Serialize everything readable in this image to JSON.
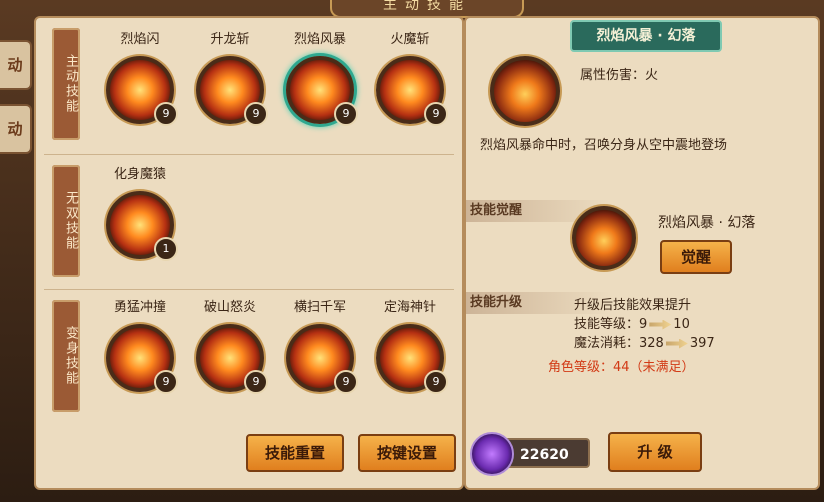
{
  "window": {
    "title": "主动技能"
  },
  "side_tabs": [
    "动",
    "动"
  ],
  "sections": [
    {
      "ribbon": "主动技能",
      "skills": [
        {
          "name": "烈焰闪",
          "level": "9"
        },
        {
          "name": "升龙斩",
          "level": "9"
        },
        {
          "name": "烈焰风暴",
          "level": "9",
          "selected": true
        },
        {
          "name": "火魔斩",
          "level": "9"
        }
      ]
    },
    {
      "ribbon": "无双技能",
      "skills": [
        {
          "name": "化身魔猿",
          "level": "1"
        }
      ]
    },
    {
      "ribbon": "变身技能",
      "skills": [
        {
          "name": "勇猛冲撞",
          "level": "9"
        },
        {
          "name": "破山怒炎",
          "level": "9"
        },
        {
          "name": "横扫千军",
          "level": "9"
        },
        {
          "name": "定海神针",
          "level": "9"
        }
      ]
    }
  ],
  "buttons": {
    "reset": "技能重置",
    "keybind": "按键设置",
    "awaken": "觉醒",
    "upgrade": "升 级"
  },
  "detail": {
    "title": "烈焰风暴 · 幻落",
    "attribute": "属性伤害：火",
    "description": "烈焰风暴命中时，召唤分身从空中震地登场",
    "awaken_label": "技能觉醒",
    "awaken_skill": "烈焰风暴 · 幻落",
    "upgrade_label": "技能升级",
    "upgrade_effect": "升级后技能效果提升",
    "level_label": "技能等级：",
    "level_from": "9",
    "level_to": "10",
    "mana_label": "魔法消耗：",
    "mana_from": "328",
    "mana_to": "397",
    "requirement": "角色等级：44（未满足）"
  },
  "currency": {
    "amount": "22620"
  }
}
